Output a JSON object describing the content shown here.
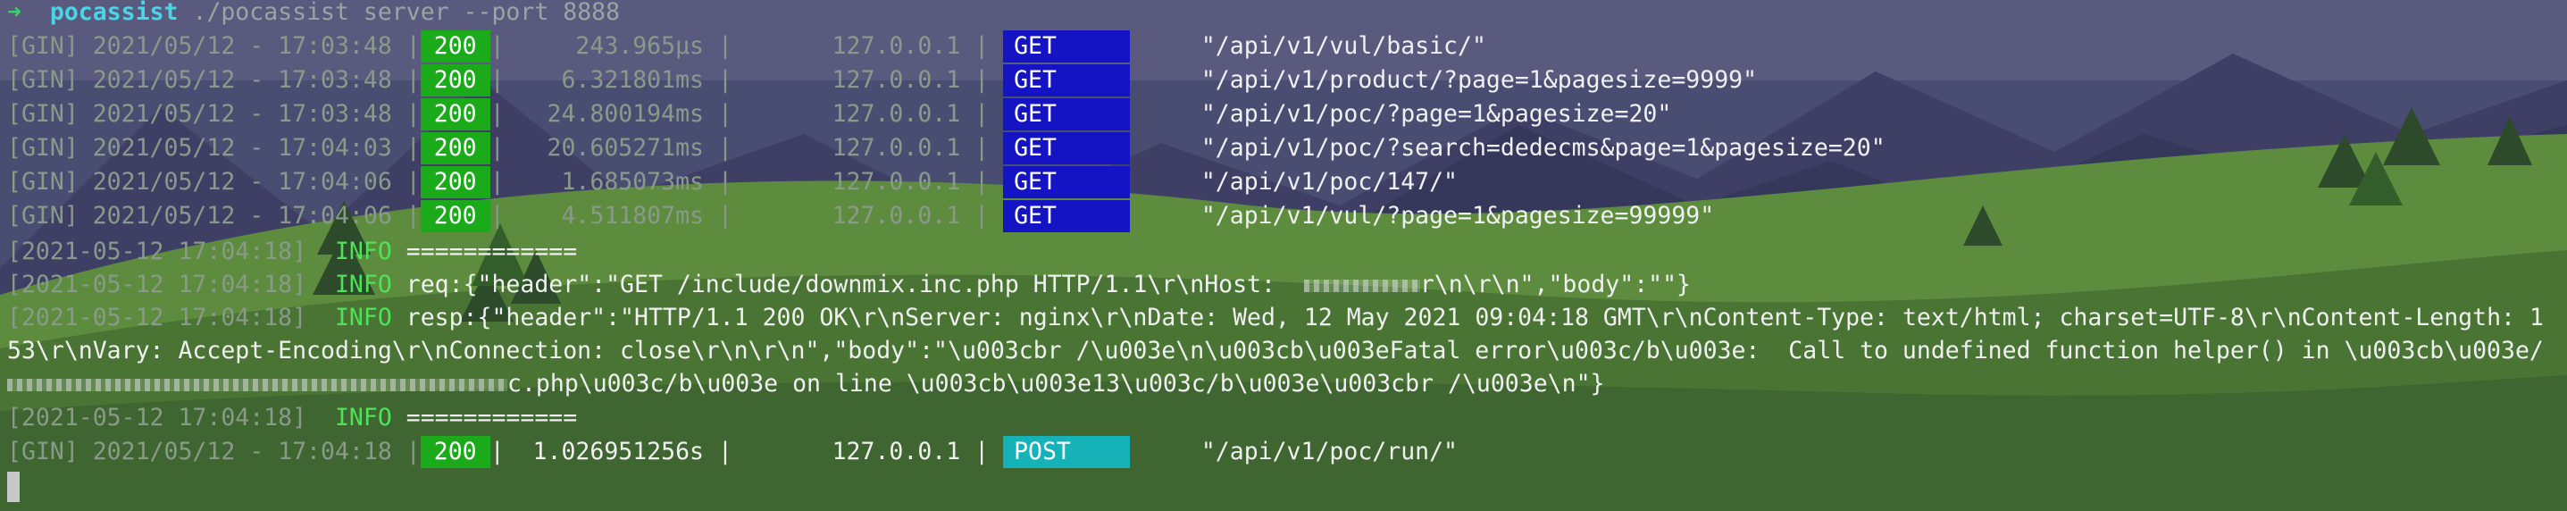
{
  "prompt": {
    "arrow": "➜",
    "dir": "pocassist",
    "command": " ./pocassist server --port 8888"
  },
  "gin_requests_top": [
    {
      "prefix": "[GIN] 2021/05/12 - 17:03:48 |",
      "status": "200",
      "latency": "|     243.965µs |       127.0.0.1 |",
      "method": "GET",
      "path": "     \"/api/v1/vul/basic/\""
    },
    {
      "prefix": "[GIN] 2021/05/12 - 17:03:48 |",
      "status": "200",
      "latency": "|    6.321801ms |       127.0.0.1 |",
      "method": "GET",
      "path": "     \"/api/v1/product/?page=1&pagesize=9999\""
    },
    {
      "prefix": "[GIN] 2021/05/12 - 17:03:48 |",
      "status": "200",
      "latency": "|   24.800194ms |       127.0.0.1 |",
      "method": "GET",
      "path": "     \"/api/v1/poc/?page=1&pagesize=20\""
    },
    {
      "prefix": "[GIN] 2021/05/12 - 17:04:03 |",
      "status": "200",
      "latency": "|   20.605271ms |       127.0.0.1 |",
      "method": "GET",
      "path": "     \"/api/v1/poc/?search=dedecms&page=1&pagesize=20\""
    },
    {
      "prefix": "[GIN] 2021/05/12 - 17:04:06 |",
      "status": "200",
      "latency": "|    1.685073ms |       127.0.0.1 |",
      "method": "GET",
      "path": "     \"/api/v1/poc/147/\""
    },
    {
      "prefix": "[GIN] 2021/05/12 - 17:04:06 |",
      "status": "200",
      "latency": "|    4.511807ms |       127.0.0.1 |",
      "method": "GET",
      "path": "     \"/api/v1/vul/?page=1&pagesize=99999\""
    }
  ],
  "log": {
    "ts": "[2021-05-12 17:04:18]",
    "level": "  INFO ",
    "sep_text": "============",
    "req_label": "req:",
    "req_a": "{\"header\":\"GET /include/downmix.inc.php HTTP/1.1\\r\\nHost:  ",
    "req_b": "r\\n\\r\\n\",\"body\":\"\"}",
    "resp_label": "resp:",
    "resp_1": "{\"header\":\"HTTP/1.1 200 OK\\r\\nServer: nginx\\r\\nDate: Wed, 12 May 2021 09:04:18 GMT\\r\\nContent-Type: text/html; charset=UTF-8\\r\\nContent-Length: 1",
    "resp_2": "53\\r\\nVary: Accept-Encoding\\r\\nConnection: close\\r\\n\\r\\n\",\"body\":\"\\u003cbr /\\u003e\\n\\u003cb\\u003eFatal error\\u003c/b\\u003e:  Call to undefined function helper() in \\u003cb\\u003e/",
    "resp_3": "c.php\\u003c/b\\u003e on line \\u003cb\\u003e13\\u003c/b\\u003e\\u003cbr /\\u003e\\n\"}"
  },
  "gin_request_bottom": {
    "prefix": "[GIN] 2021/05/12 - 17:04:18 |",
    "status": "200",
    "latency": "|  1.026951256s |       127.0.0.1 |",
    "method": "POST",
    "path": "     \"/api/v1/poc/run/\""
  }
}
